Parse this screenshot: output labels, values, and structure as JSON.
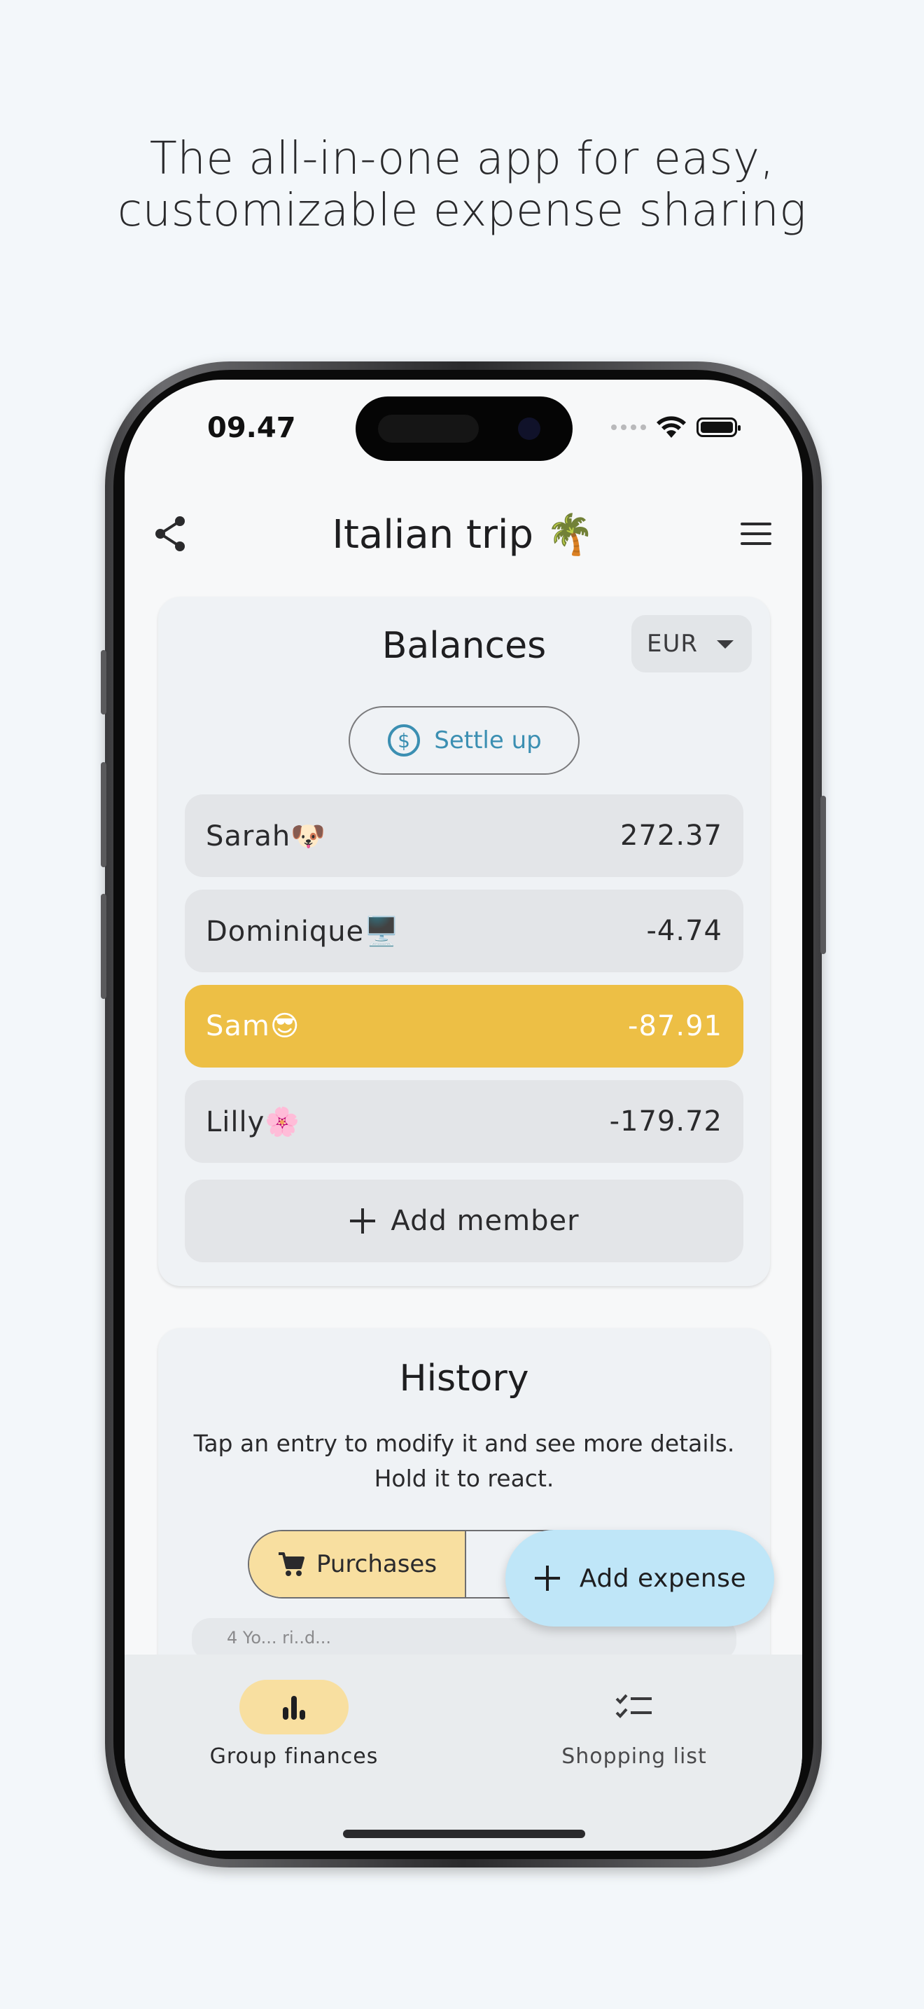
{
  "headline": {
    "line1": "The all-in-one app for easy,",
    "line2": "customizable expense sharing"
  },
  "status_bar": {
    "time": "09.47"
  },
  "app_bar": {
    "title": "Italian trip 🌴"
  },
  "balances": {
    "title": "Balances",
    "currency": "EUR",
    "settle_label": "Settle up",
    "members": [
      {
        "name": "Sarah🐶",
        "amount": "272.37",
        "highlighted": false
      },
      {
        "name": "Dominique🖥️",
        "amount": "-4.74",
        "highlighted": false
      },
      {
        "name": "Sam😎",
        "amount": "-87.91",
        "highlighted": true
      },
      {
        "name": "Lilly🌸",
        "amount": "-179.72",
        "highlighted": false
      }
    ],
    "add_member_label": "Add member"
  },
  "history": {
    "title": "History",
    "subtitle_line1": "Tap an entry to modify it and see more details.",
    "subtitle_line2": "Hold it to react.",
    "tab_purchases": "Purchases",
    "peek_text": "4 Yo... ri..d..."
  },
  "fab": {
    "label": "Add expense"
  },
  "bottom_nav": {
    "items": [
      {
        "label": "Group finances",
        "icon": "bar-chart-icon",
        "active": true
      },
      {
        "label": "Shopping list",
        "icon": "checklist-icon",
        "active": false
      }
    ]
  },
  "colors": {
    "background": "#f3f7fa",
    "highlight_row": "#edbf45",
    "active_pill": "#f8dfa0",
    "fab": "#bfe6f8",
    "settle_accent": "#3b8fb2"
  }
}
